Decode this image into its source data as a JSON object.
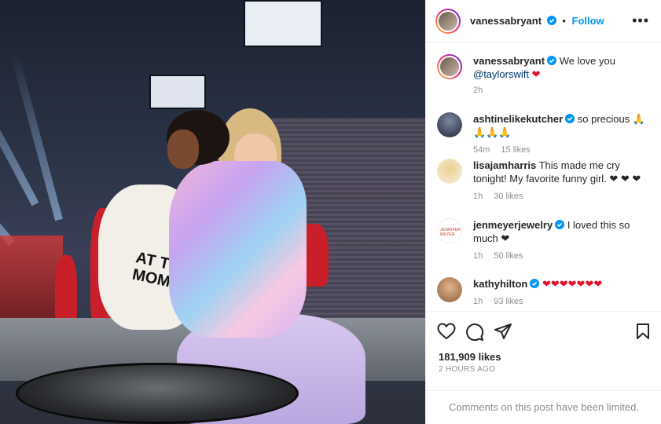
{
  "post": {
    "author": "vanessabryant",
    "follow_label": "Follow",
    "separator": "•",
    "photo_tee_text": "AT T MOM",
    "caption": {
      "text": "We love you",
      "mention": "@taylorswift",
      "heart": "❤",
      "time": "2h"
    }
  },
  "comments": [
    {
      "user": "ashtinelikekutcher",
      "verified": true,
      "text": "so precious 🙏🙏🙏🙏",
      "time": "54m",
      "likes": "15 likes",
      "reply": ""
    },
    {
      "user": "lisajamharris",
      "verified": false,
      "text": "This made me cry tonight! My favorite funny girl. ❤ ❤ ❤",
      "time": "1h",
      "likes": "30 likes",
      "reply": ""
    },
    {
      "user": "jenmeyerjewelry",
      "verified": true,
      "text": "I loved this so much ❤",
      "time": "1h",
      "likes": "50 likes",
      "reply": ""
    },
    {
      "user": "kathyhilton",
      "verified": true,
      "text": "❤❤❤❤❤❤❤",
      "time": "1h",
      "likes": "93 likes",
      "reply": ""
    }
  ],
  "actions": {
    "likes_count": "181,909 likes",
    "time_ago": "2 HOURS AGO",
    "comments_limited": "Comments on this post have been limited."
  },
  "colors": {
    "accent": "#0095f6",
    "heart": "#e0112b",
    "muted": "#8e8e8e"
  },
  "icons": [
    "verified-badge-icon",
    "more-options-icon",
    "like-icon",
    "comment-icon",
    "share-icon",
    "save-icon"
  ]
}
